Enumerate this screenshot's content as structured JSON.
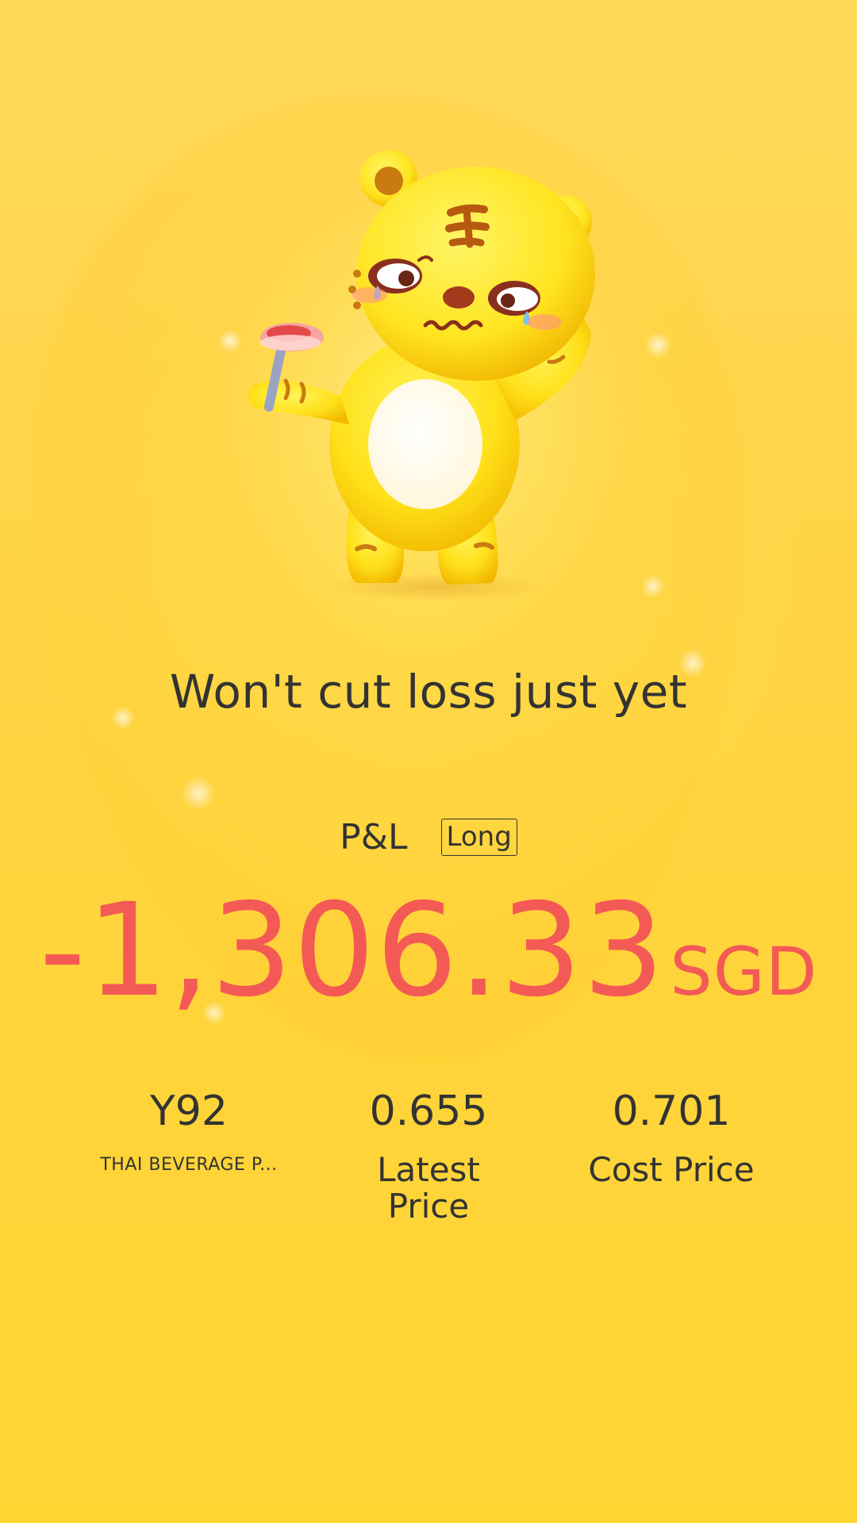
{
  "headline": "Won't cut loss just yet",
  "pnl": {
    "label": "P&L",
    "position_badge": "Long",
    "amount": "-1,306.33",
    "currency": "SGD",
    "amount_color": "#f45a55"
  },
  "stats": [
    {
      "value": "Y92",
      "label": "THAI BEVERAGE P..."
    },
    {
      "value": "0.655",
      "label": "Latest Price"
    },
    {
      "value": "0.701",
      "label": "Cost Price"
    }
  ],
  "mascot": {
    "icon": "tiger-mascot-icon"
  },
  "colors": {
    "background": "#ffd33a",
    "text": "#333333",
    "loss": "#f45a55"
  }
}
